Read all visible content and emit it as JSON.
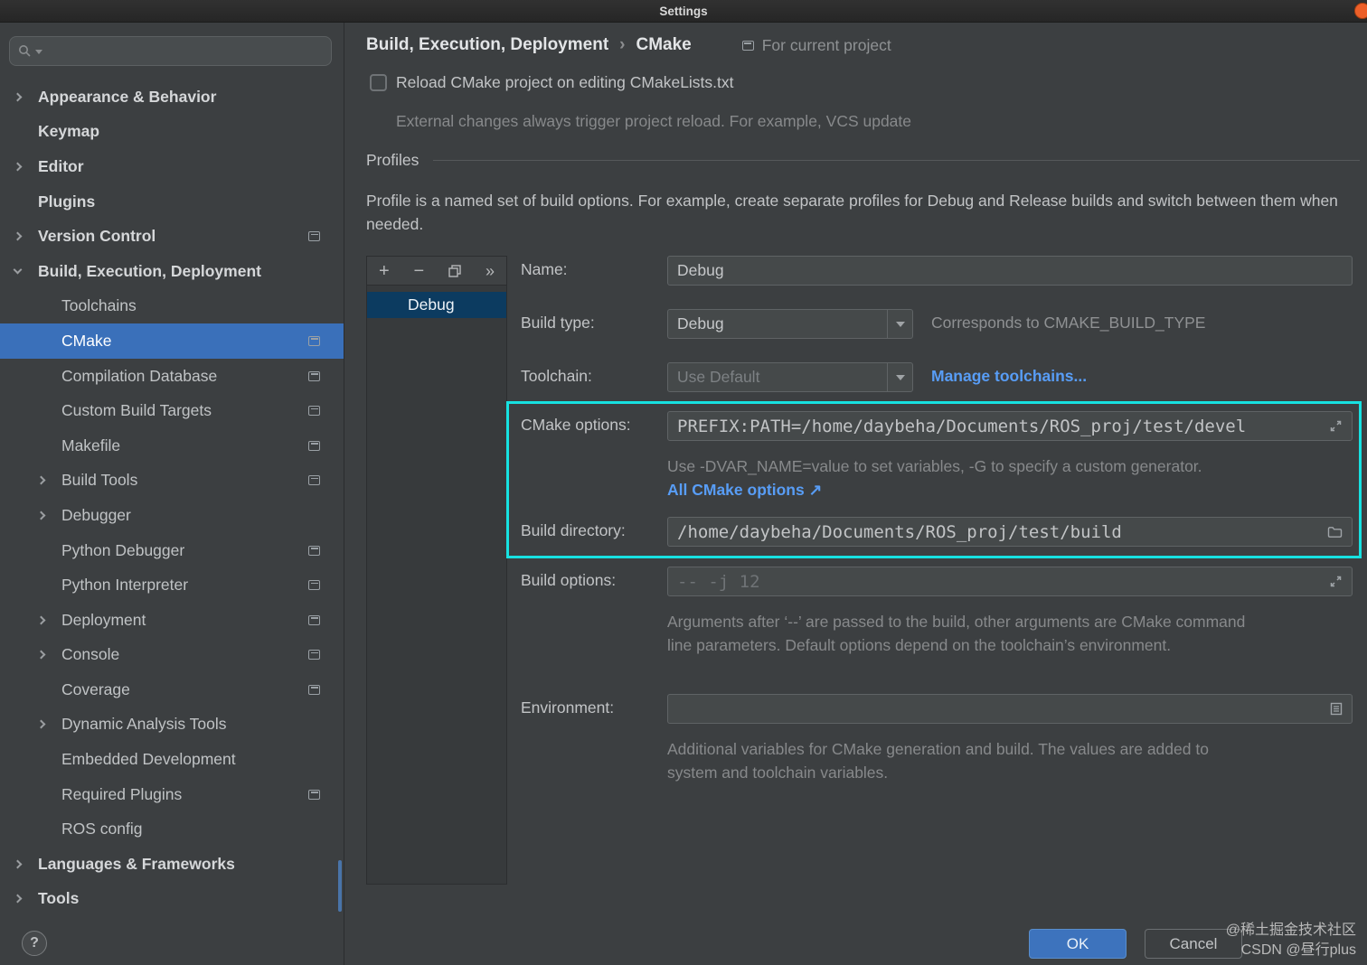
{
  "colors": {
    "background": "#3c3f41",
    "sidebar_selection": "#3a70ba",
    "list_selection": "#0c3b60",
    "field_background": "#45494a",
    "link_blue": "#589df6",
    "highlight_cyan": "#17e1e1",
    "ok_button_blue": "#3d73bd",
    "titlebar_close_orange": "#ec5f29"
  },
  "titlebar": {
    "title": "Settings"
  },
  "sidebar": {
    "search": {
      "placeholder": "",
      "icon": "search-icon"
    },
    "help": "?",
    "items": [
      {
        "label": "Appearance & Behavior",
        "level": 0,
        "bold": true,
        "chevron": "right"
      },
      {
        "label": "Keymap",
        "level": 0,
        "bold": true
      },
      {
        "label": "Editor",
        "level": 0,
        "bold": true,
        "chevron": "right"
      },
      {
        "label": "Plugins",
        "level": 0,
        "bold": true
      },
      {
        "label": "Version Control",
        "level": 0,
        "bold": true,
        "chevron": "right",
        "project_icon": true
      },
      {
        "label": "Build, Execution, Deployment",
        "level": 0,
        "bold": true,
        "chevron": "down"
      },
      {
        "label": "Toolchains",
        "level": 1
      },
      {
        "label": "CMake",
        "level": 1,
        "selected": true,
        "project_icon": true
      },
      {
        "label": "Compilation Database",
        "level": 1,
        "project_icon": true
      },
      {
        "label": "Custom Build Targets",
        "level": 1,
        "project_icon": true
      },
      {
        "label": "Makefile",
        "level": 1,
        "project_icon": true
      },
      {
        "label": "Build Tools",
        "level": 1,
        "chevron": "right",
        "project_icon": true
      },
      {
        "label": "Debugger",
        "level": 1,
        "chevron": "right"
      },
      {
        "label": "Python Debugger",
        "level": 1,
        "project_icon": true
      },
      {
        "label": "Python Interpreter",
        "level": 1,
        "project_icon": true
      },
      {
        "label": "Deployment",
        "level": 1,
        "chevron": "right",
        "project_icon": true
      },
      {
        "label": "Console",
        "level": 1,
        "chevron": "right",
        "project_icon": true
      },
      {
        "label": "Coverage",
        "level": 1,
        "project_icon": true
      },
      {
        "label": "Dynamic Analysis Tools",
        "level": 1,
        "chevron": "right"
      },
      {
        "label": "Embedded Development",
        "level": 1
      },
      {
        "label": "Required Plugins",
        "level": 1,
        "project_icon": true
      },
      {
        "label": "ROS config",
        "level": 1
      },
      {
        "label": "Languages & Frameworks",
        "level": 0,
        "bold": true,
        "chevron": "right"
      },
      {
        "label": "Tools",
        "level": 0,
        "bold": true,
        "chevron": "right"
      }
    ]
  },
  "header": {
    "breadcrumb_parent": "Build, Execution, Deployment",
    "breadcrumb_separator": "›",
    "breadcrumb_current": "CMake",
    "scope": "For current project"
  },
  "reload": {
    "checkbox_checked": false,
    "label": "Reload CMake project on editing CMakeLists.txt",
    "help": "External changes always trigger project reload. For example, VCS update"
  },
  "profiles": {
    "section_title": "Profiles",
    "description": "Profile is a named set of build options. For example, create separate profiles for Debug and Release builds and switch between them when needed.",
    "toolbar": {
      "add": "+",
      "remove": "−",
      "more": "»"
    },
    "items": [
      {
        "name": "Debug",
        "selected": true
      }
    ]
  },
  "form": {
    "name": {
      "label": "Name:",
      "value": "Debug"
    },
    "build_type": {
      "label": "Build type:",
      "value": "Debug",
      "note": "Corresponds to CMAKE_BUILD_TYPE"
    },
    "toolchain": {
      "label": "Toolchain:",
      "value": "Use Default",
      "link": "Manage toolchains..."
    },
    "cmake_options": {
      "label": "CMake options:",
      "value": "PREFIX:PATH=/home/daybeha/Documents/ROS_proj/test/devel",
      "help": "Use -DVAR_NAME=value to set variables, -G to specify a custom generator.",
      "link": "All CMake options",
      "link_arrow": "↗"
    },
    "build_directory": {
      "label": "Build directory:",
      "value": "/home/daybeha/Documents/ROS_proj/test/build"
    },
    "build_options": {
      "label": "Build options:",
      "placeholder": "-- -j 12",
      "help": "Arguments after ‘--’ are passed to the build, other arguments are CMake command line parameters. Default options depend on the toolchain’s environment."
    },
    "environment": {
      "label": "Environment:",
      "value": "",
      "help": "Additional variables for CMake generation and build. The values are added to system and toolchain variables."
    }
  },
  "footer": {
    "ok": "OK",
    "cancel": "Cancel"
  },
  "watermark": {
    "line1": "@稀土掘金技术社区",
    "line2": "CSDN @昼行plus"
  }
}
